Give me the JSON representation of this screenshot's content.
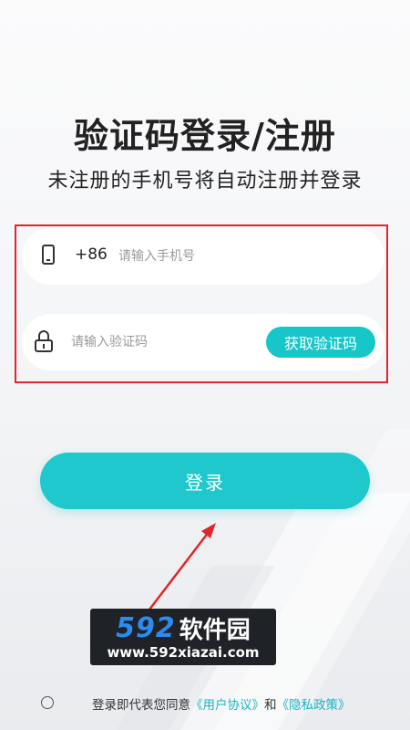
{
  "page": {
    "title": "验证码登录/注册",
    "subtitle": "未注册的手机号将自动注册并登录"
  },
  "phone_field": {
    "country_code": "+86",
    "placeholder": "请输入手机号",
    "value": ""
  },
  "code_field": {
    "placeholder": "请输入验证码",
    "value": "",
    "get_code_label": "获取验证码"
  },
  "login_button": {
    "label": "登录"
  },
  "watermark": {
    "number": "592",
    "name": "软件园",
    "url": "www.592xiazai.com"
  },
  "agreement": {
    "prefix": "登录即代表您同意",
    "user_agreement": "《用户协议》",
    "and": "和",
    "privacy_policy": "《隐私政策》",
    "checked": false
  },
  "icons": {
    "phone": "phone-icon",
    "lock": "lock-icon"
  },
  "colors": {
    "accent": "#1ec8cc",
    "highlight_box": "#e0262a",
    "link": "#17b6c4"
  }
}
